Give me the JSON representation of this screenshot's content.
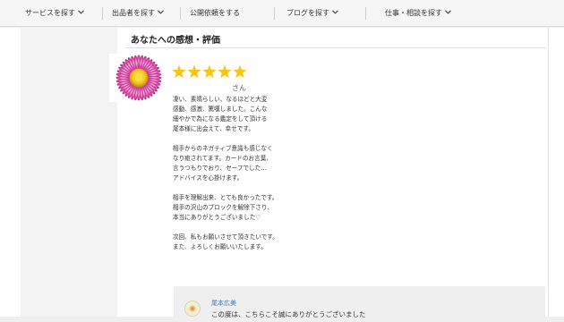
{
  "nav": {
    "items": [
      {
        "label": "サービスを探す"
      },
      {
        "label": "出品者を探す"
      },
      {
        "label": "公開依頼をする"
      },
      {
        "label": "ブログを探す"
      },
      {
        "label": "仕事・相談を探す"
      }
    ]
  },
  "review": {
    "section_title": "あなたへの感想・評価",
    "rating": 5,
    "rating_max": 5,
    "star_color": "#f5c518",
    "reviewer_suffix": "さん",
    "lines": [
      "凄い、素晴らしい、なるほどと大変",
      "感動、感激、驚嘆しました。こんな",
      "細やかで為になる鑑定をして頂ける",
      "尾本様に出会えて、幸せです。",
      "",
      "相手からのネガティブ意識も感じなく",
      "なり癒されてます。カードのお言葉、",
      "言うつもりでおり、セーフでした…",
      "アドバイスを心掛けます。",
      "",
      "相手を理解出来、とても良かったです。",
      "相手の沢山のブロックを解除下さり、",
      "本当にありがとうございました♡",
      "",
      "次回、私もお願いさせて頂きたいです。",
      "また、よろしくお願いいたします。"
    ]
  },
  "reply": {
    "name": "尾本広美",
    "text": "この度は、こちらこそ誠にありがとうございました"
  },
  "colors": {
    "link": "#3a7bbf",
    "reply_bg": "#efefef"
  }
}
